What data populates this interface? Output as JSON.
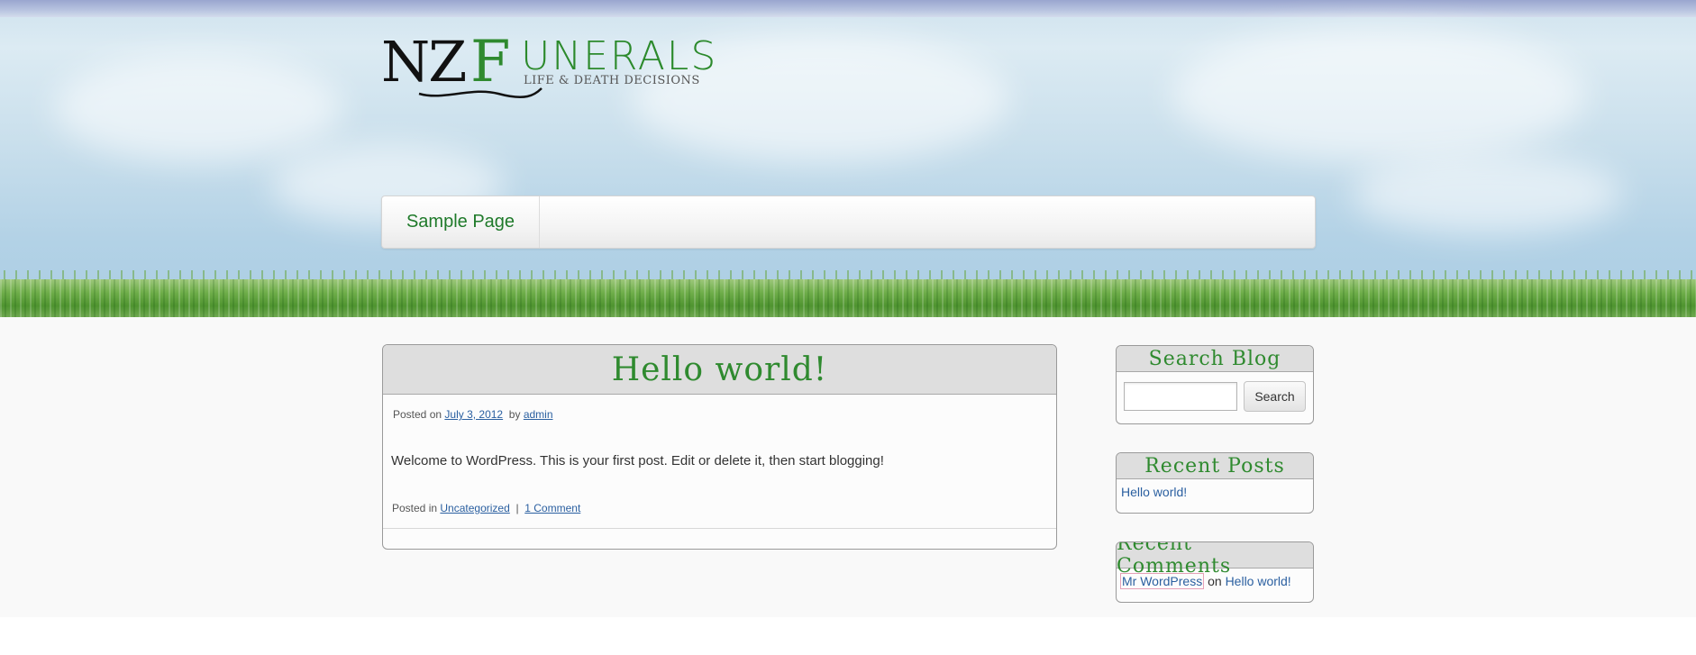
{
  "site": {
    "logo_nz": "NZ",
    "logo_f": "F",
    "logo_unerals": "UNERALS",
    "tagline": "LIFE & DEATH DECISIONS"
  },
  "nav": {
    "items": [
      {
        "label": "Sample Page"
      }
    ]
  },
  "post": {
    "title": "Hello world!",
    "posted_on": "Posted on",
    "date": "July 3, 2012",
    "by": "by",
    "author": "admin",
    "content": "Welcome to WordPress. This is your first post. Edit or delete it, then start blogging!",
    "posted_in": "Posted in",
    "category": "Uncategorized",
    "separator": "|",
    "comments": "1 Comment"
  },
  "sidebar": {
    "search": {
      "title": "Search Blog",
      "placeholder": "",
      "button": "Search"
    },
    "recent_posts": {
      "title": "Recent Posts",
      "items": [
        "Hello world!"
      ]
    },
    "recent_comments": {
      "title": "Recent Comments",
      "items": [
        {
          "author": "Mr WordPress",
          "on": "on",
          "post": "Hello world!"
        }
      ]
    }
  },
  "colors": {
    "accent_green": "#2f8a2f",
    "link_blue": "#2a5fa0"
  }
}
